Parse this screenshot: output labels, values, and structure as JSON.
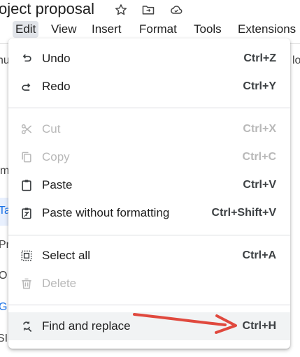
{
  "doc": {
    "title": "oject proposal"
  },
  "menubar": {
    "items": [
      {
        "label": "Edit",
        "active": true
      },
      {
        "label": "View"
      },
      {
        "label": "Insert"
      },
      {
        "label": "Format"
      },
      {
        "label": "Tools"
      },
      {
        "label": "Extensions"
      }
    ]
  },
  "background": {
    "frag_top_left": "nu",
    "frag_top_right": "lo",
    "frag_m": "m",
    "frag_ta": "Ta",
    "frag_pr": "Pr",
    "frag_o": "O",
    "frag_g": "G",
    "frag_sl": "SI"
  },
  "edit_menu": {
    "undo": {
      "label": "Undo",
      "shortcut": "Ctrl+Z",
      "icon": "undo-icon"
    },
    "redo": {
      "label": "Redo",
      "shortcut": "Ctrl+Y",
      "icon": "redo-icon"
    },
    "cut": {
      "label": "Cut",
      "shortcut": "Ctrl+X",
      "icon": "scissors-icon",
      "disabled": true
    },
    "copy": {
      "label": "Copy",
      "shortcut": "Ctrl+C",
      "icon": "copy-icon",
      "disabled": true
    },
    "paste": {
      "label": "Paste",
      "shortcut": "Ctrl+V",
      "icon": "clipboard-icon"
    },
    "paste_plain": {
      "label": "Paste without formatting",
      "shortcut": "Ctrl+Shift+V",
      "icon": "clipboard-plain-icon"
    },
    "select_all": {
      "label": "Select all",
      "shortcut": "Ctrl+A",
      "icon": "select-all-icon"
    },
    "delete": {
      "label": "Delete",
      "shortcut": "",
      "icon": "trash-icon",
      "disabled": true
    },
    "find_replace": {
      "label": "Find and replace",
      "shortcut": "Ctrl+H",
      "icon": "find-replace-icon",
      "highlighted": true
    }
  },
  "colors": {
    "annotation_arrow": "#e0493e",
    "menu_active_bg": "#e1e4e9",
    "disabled_text": "#b8b8b8"
  }
}
